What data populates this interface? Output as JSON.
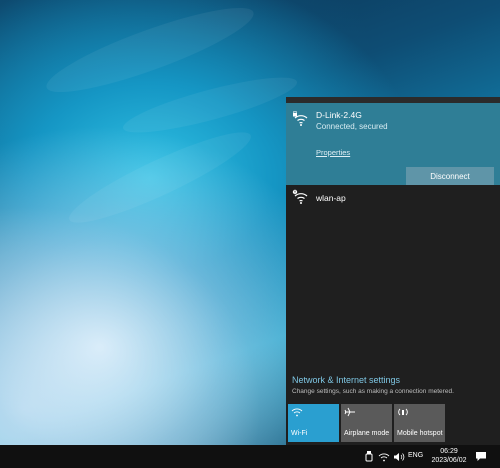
{
  "flyout": {
    "active_network": {
      "name": "D-Link-2.4G",
      "status": "Connected, secured",
      "properties_label": "Properties",
      "disconnect_label": "Disconnect"
    },
    "networks": [
      {
        "name": "wlan-ap"
      }
    ],
    "settings": {
      "title": "Network & Internet settings",
      "subtitle": "Change settings, such as making a connection metered."
    },
    "tiles": [
      {
        "label": "Wi-Fi",
        "icon": "wifi-icon",
        "active": true
      },
      {
        "label": "Airplane mode",
        "icon": "airplane-icon",
        "active": false
      },
      {
        "label": "Mobile hotspot",
        "icon": "hotspot-icon",
        "active": false
      }
    ]
  },
  "taskbar": {
    "language": "ENG",
    "time": "06:29",
    "date": "2023/06/02"
  },
  "colors": {
    "accent": "#2f7e96",
    "tile_active": "#2a9fd0",
    "tile_inactive": "#5a5a5a",
    "panel_bg": "#1f1f1f",
    "link": "#7fc7e4"
  }
}
